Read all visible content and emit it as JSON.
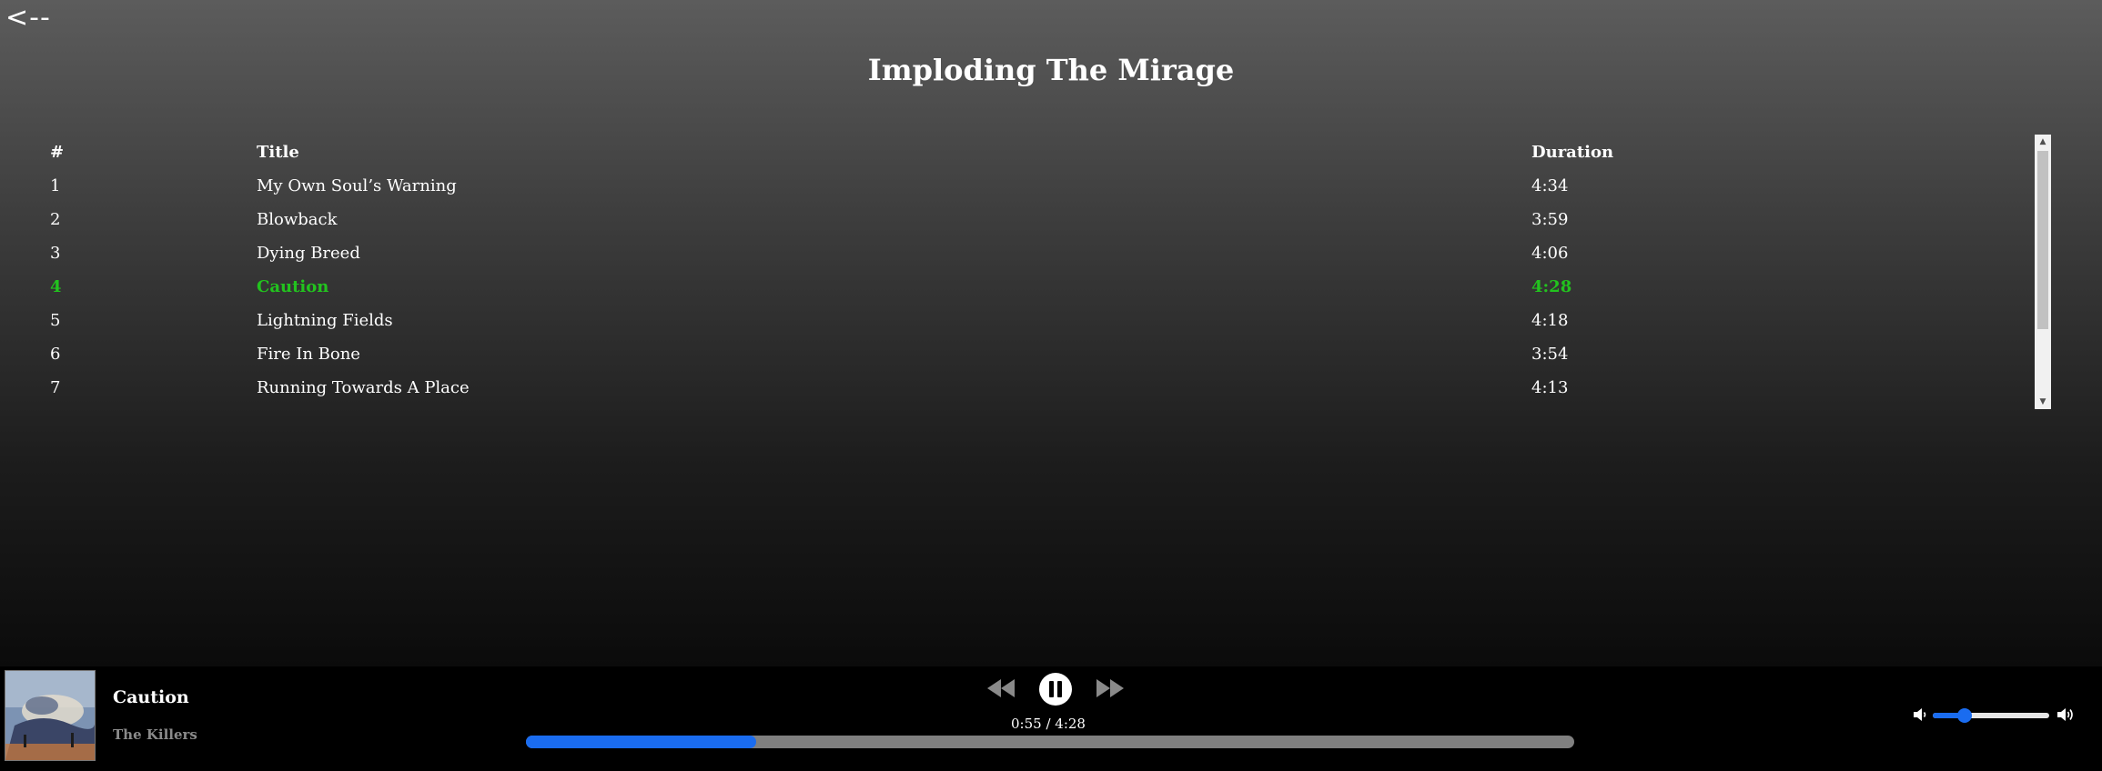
{
  "nav": {
    "back_label": "<--"
  },
  "album": {
    "title": "Imploding The Mirage"
  },
  "track_table": {
    "headers": {
      "number": "#",
      "title": "Title",
      "duration": "Duration"
    },
    "tracks": [
      {
        "number": "1",
        "title": "My Own Soul’s Warning",
        "duration": "4:34",
        "active": false
      },
      {
        "number": "2",
        "title": "Blowback",
        "duration": "3:59",
        "active": false
      },
      {
        "number": "3",
        "title": "Dying Breed",
        "duration": "4:06",
        "active": false
      },
      {
        "number": "4",
        "title": "Caution",
        "duration": "4:28",
        "active": true
      },
      {
        "number": "5",
        "title": "Lightning Fields",
        "duration": "4:18",
        "active": false
      },
      {
        "number": "6",
        "title": "Fire In Bone",
        "duration": "3:54",
        "active": false
      },
      {
        "number": "7",
        "title": "Running Towards A Place",
        "duration": "4:13",
        "active": false
      }
    ]
  },
  "player": {
    "track_title": "Caution",
    "artist": "The Killers",
    "time_display": "0:55 / 4:28",
    "progress_fraction": 0.22,
    "volume_fraction": 0.27,
    "icons": {
      "prev": "rewind-icon",
      "play_state": "pause-icon",
      "next": "fast-forward-icon",
      "volume_low": "volume-low-icon",
      "volume_high": "volume-high-icon"
    }
  },
  "colors": {
    "active_track": "#22c31e",
    "progress_fill": "#1a6cf0",
    "progress_bg": "#808080",
    "artist_text": "#8a8a8a"
  }
}
